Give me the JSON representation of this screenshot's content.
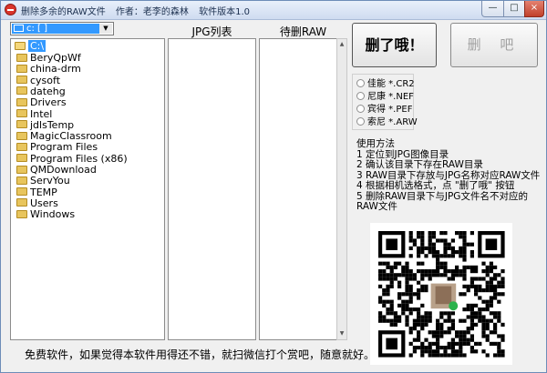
{
  "window": {
    "title": "删除多余的RAW文件",
    "author": "作者：老李的森林",
    "version": "软件版本1.0",
    "controls": {
      "minimize": "—",
      "maximize": "□",
      "close": "×"
    }
  },
  "drive_select": {
    "value": "c: [ ]",
    "icon": "drive-icon"
  },
  "directory_tree": {
    "root": "C:\\",
    "items": [
      "BeryQpWf",
      "china-drm",
      "cysoft",
      "datehg",
      "Drivers",
      "Intel",
      "jdlsTemp",
      "MagicClassroom",
      "Program Files",
      "Program Files (x86)",
      "QMDownload",
      "ServYou",
      "TEMP",
      "Users",
      "Windows"
    ]
  },
  "lists": {
    "jpg_header": "JPG列表",
    "raw_header": "待删RAW"
  },
  "buttons": {
    "delete_primary": "删了哦！",
    "delete_secondary": "删 吧"
  },
  "camera_options": [
    {
      "label": "佳能 *.CR2"
    },
    {
      "label": "尼康 *.NEF"
    },
    {
      "label": "宾得 *.PEF"
    },
    {
      "label": "索尼 *.ARW"
    }
  ],
  "instructions": {
    "title": "使用方法",
    "steps": [
      "1 定位到JPG图像目录",
      "2 确认该目录下存在RAW目录",
      "3 RAW目录下存放与JPG名称对应RAW文件",
      "4 根据相机选格式，点 \"删了哦\" 按钮",
      "5 删除RAW目录下与JPG文件名不对应的",
      "   RAW文件"
    ]
  },
  "footer": {
    "text": "免费软件，如果觉得本软件用得还不错，就扫微信打个赏吧，随意就好。"
  },
  "qr": {
    "icon": "wechat-qr-code"
  }
}
